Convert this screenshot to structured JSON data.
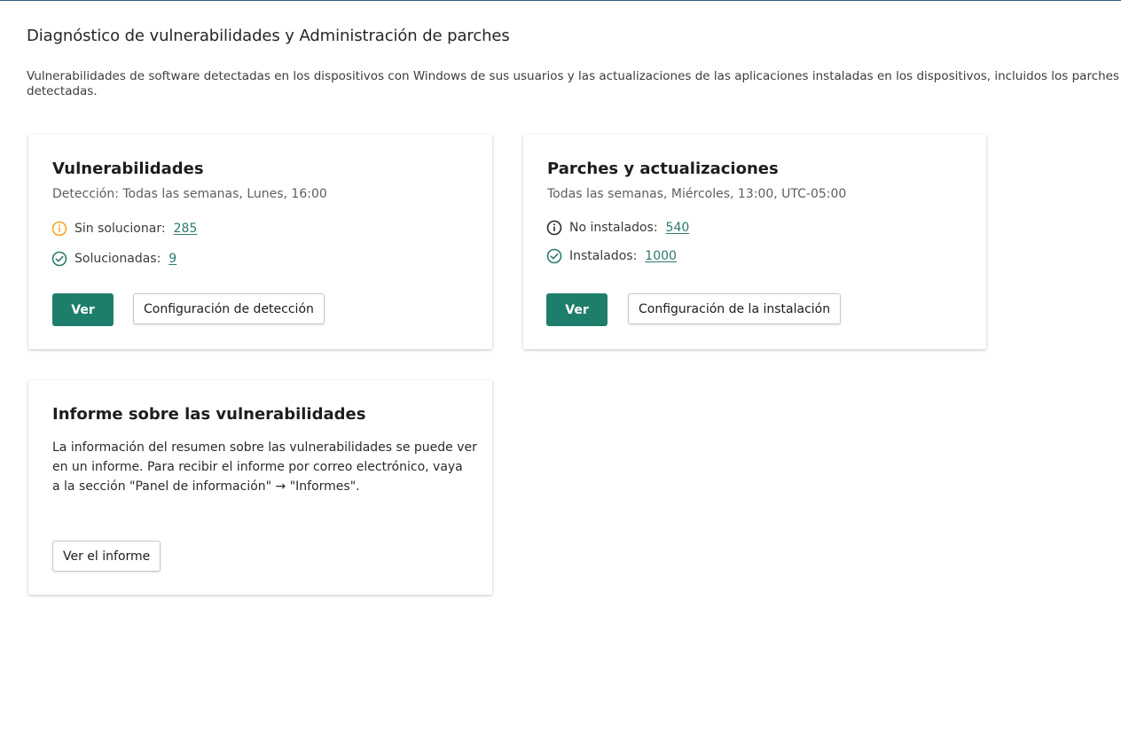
{
  "header": {
    "title": "Diagnóstico de vulnerabilidades y Administración de parches",
    "description_line1": "Vulnerabilidades de software detectadas en los dispositivos con Windows de sus usuarios y las actualizaciones de las aplicaciones instaladas en los dispositivos, incluidos los parches",
    "description_line2": "detectadas."
  },
  "vulnerabilities_card": {
    "title": "Vulnerabilidades",
    "subtitle": "Detección: Todas las semanas, Lunes, 16:00",
    "unresolved_label": "Sin solucionar:",
    "unresolved_count": "285",
    "resolved_label": "Solucionadas:",
    "resolved_count": "9",
    "view_button": "Ver",
    "settings_button": "Configuración de detección"
  },
  "patches_card": {
    "title": "Parches y actualizaciones",
    "subtitle": "Todas las semanas, Miércoles, 13:00, UTC-05:00",
    "not_installed_label": "No instalados:",
    "not_installed_count": "540",
    "installed_label": "Instalados:",
    "installed_count": "1000",
    "view_button": "Ver",
    "settings_button": "Configuración de la instalación"
  },
  "report_card": {
    "title": "Informe sobre las vulnerabilidades",
    "text_line1": "La información del resumen sobre las vulnerabilidades se puede ver",
    "text_line2": "en un informe. Para recibir el informe por correo electrónico, vaya",
    "text_line3": "a la sección \"Panel de información\" → \"Informes\".",
    "view_report_button": "Ver el informe"
  },
  "colors": {
    "accent": "#1f7e6b",
    "link": "#2b7a6e",
    "warning": "#f5a623",
    "top_border": "#2f5f7f"
  },
  "icons": {
    "unresolved": "warning-circle-icon",
    "resolved": "check-circle-icon",
    "not_installed": "info-circle-icon",
    "installed": "check-circle-icon"
  }
}
